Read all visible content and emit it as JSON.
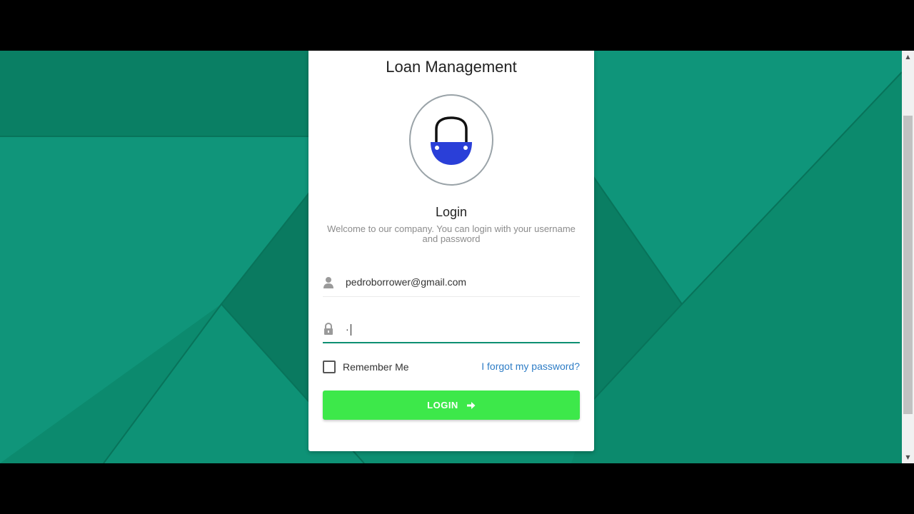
{
  "app": {
    "title": "Loan Management"
  },
  "logo": {
    "icon": "basket-icon",
    "color": "#2a3fd8"
  },
  "login": {
    "heading": "Login",
    "welcome": "Welcome to our company. You can login with your username and password"
  },
  "form": {
    "username": {
      "value": "pedroborrower@gmail.com",
      "icon": "user-icon"
    },
    "password": {
      "value": "·",
      "icon": "lock-icon"
    },
    "remember_label": "Remember Me",
    "forgot_label": "I forgot my password?",
    "submit_label": "LOGIN",
    "submit_icon": "arrow-right-icon"
  },
  "colors": {
    "background": "#0d8f72",
    "button": "#3de84a",
    "link": "#2e7dc6",
    "focus_underline": "#0d8f72"
  }
}
